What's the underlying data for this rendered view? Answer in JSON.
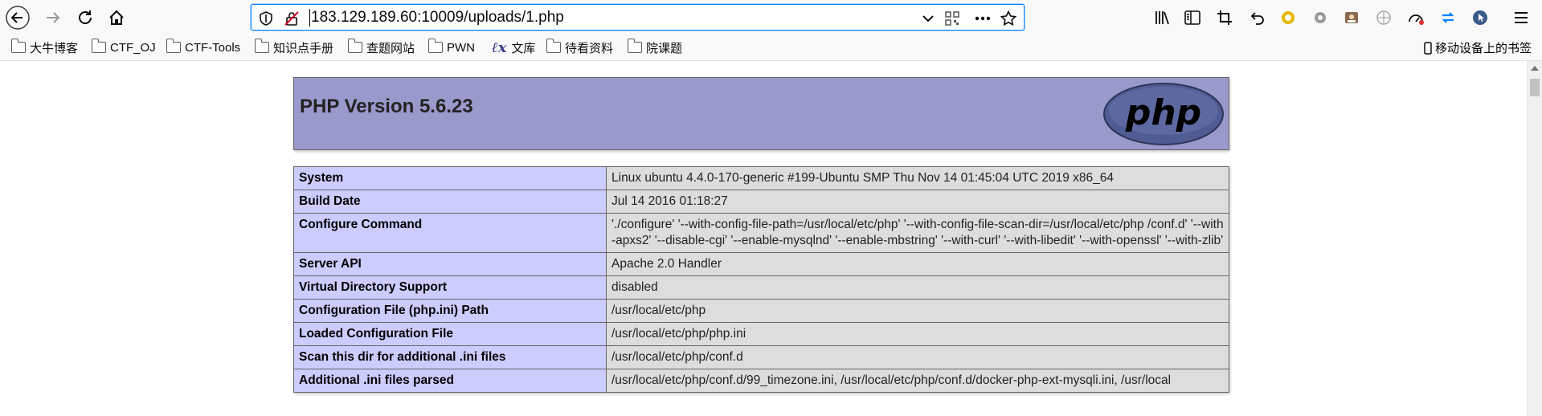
{
  "browser": {
    "url": "183.129.189.60:10009/uploads/1.php",
    "icons": {
      "back": "back-arrow-icon",
      "forward": "forward-arrow-icon",
      "reload": "reload-icon",
      "home": "home-icon",
      "shield": "tracking-protection-shield-icon",
      "insecure": "insecure-connection-icon",
      "dropdown": "chevron-down-icon",
      "qr": "qr-code-icon",
      "page_actions": "more-horizontal-icon",
      "star": "bookmark-star-icon",
      "library": "library-icon",
      "sidebar": "sidebar-icon",
      "crop": "screenshot-crop-icon",
      "undo": "undo-arrow-icon",
      "menu": "hamburger-menu-icon"
    },
    "accent_color": "#0a84ff"
  },
  "bookmarks": {
    "items": [
      {
        "label": "大牛博客",
        "icon": "folder-icon"
      },
      {
        "label": "CTF_OJ",
        "icon": "folder-icon"
      },
      {
        "label": "CTF-Tools",
        "icon": "folder-icon"
      },
      {
        "label": "知识点手册",
        "icon": "folder-icon"
      },
      {
        "label": "查题网站",
        "icon": "folder-icon"
      },
      {
        "label": "PWN",
        "icon": "folder-icon"
      },
      {
        "label": "文库",
        "icon": "wenku-logo-icon"
      },
      {
        "label": "待看资料",
        "icon": "folder-icon"
      },
      {
        "label": "院课题",
        "icon": "folder-icon"
      }
    ],
    "mobile_label": "移动设备上的书签"
  },
  "phpinfo": {
    "title": "PHP Version 5.6.23",
    "logo_text": "php",
    "header_color": "#9999cc",
    "key_color": "#ccccff",
    "value_color": "#dddddd",
    "rows": [
      {
        "key": "System",
        "value": "Linux ubuntu 4.4.0-170-generic #199-Ubuntu SMP Thu Nov 14 01:45:04 UTC 2019 x86_64"
      },
      {
        "key": "Build Date",
        "value": "Jul 14 2016 01:18:27"
      },
      {
        "key": "Configure Command",
        "value": "'./configure' '--with-config-file-path=/usr/local/etc/php' '--with-config-file-scan-dir=/usr/local/etc/php /conf.d' '--with-apxs2' '--disable-cgi' '--enable-mysqlnd' '--enable-mbstring' '--with-curl' '--with-libedit' '--with-openssl' '--with-zlib'"
      },
      {
        "key": "Server API",
        "value": "Apache 2.0 Handler"
      },
      {
        "key": "Virtual Directory Support",
        "value": "disabled"
      },
      {
        "key": "Configuration File (php.ini) Path",
        "value": "/usr/local/etc/php"
      },
      {
        "key": "Loaded Configuration File",
        "value": "/usr/local/etc/php/php.ini"
      },
      {
        "key": "Scan this dir for additional .ini files",
        "value": "/usr/local/etc/php/conf.d"
      },
      {
        "key": "Additional .ini files parsed",
        "value": "/usr/local/etc/php/conf.d/99_timezone.ini, /usr/local/etc/php/conf.d/docker-php-ext-mysqli.ini, /usr/local"
      }
    ]
  }
}
